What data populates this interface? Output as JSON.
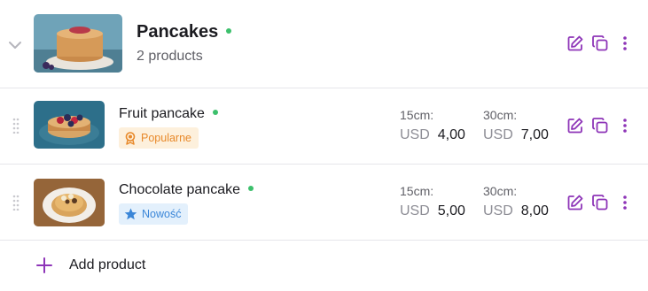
{
  "category": {
    "name": "Pancakes",
    "subtitle": "2 products",
    "status_color": "#3cc06c",
    "icons": [
      "chevron-down-icon",
      "edit-icon",
      "duplicate-icon",
      "more-vertical-icon"
    ]
  },
  "products": [
    {
      "name": "Fruit pancake",
      "badge": "Popularne",
      "badge_icon": "award-icon",
      "badge_color": "#e8892a",
      "sizes": [
        {
          "label": "15cm:",
          "currency": "USD",
          "amount": "4,00"
        },
        {
          "label": "30cm:",
          "currency": "USD",
          "amount": "7,00"
        }
      ]
    },
    {
      "name": "Chocolate pancake",
      "badge": "Nowość",
      "badge_icon": "star-icon",
      "badge_color": "#3a86d8",
      "sizes": [
        {
          "label": "15cm:",
          "currency": "USD",
          "amount": "5,00"
        },
        {
          "label": "30cm:",
          "currency": "USD",
          "amount": "8,00"
        }
      ]
    }
  ],
  "add_product": {
    "label": "Add product",
    "icon": "plus-icon"
  },
  "colors": {
    "accent": "#8e35b8",
    "status": "#3cc06c"
  }
}
